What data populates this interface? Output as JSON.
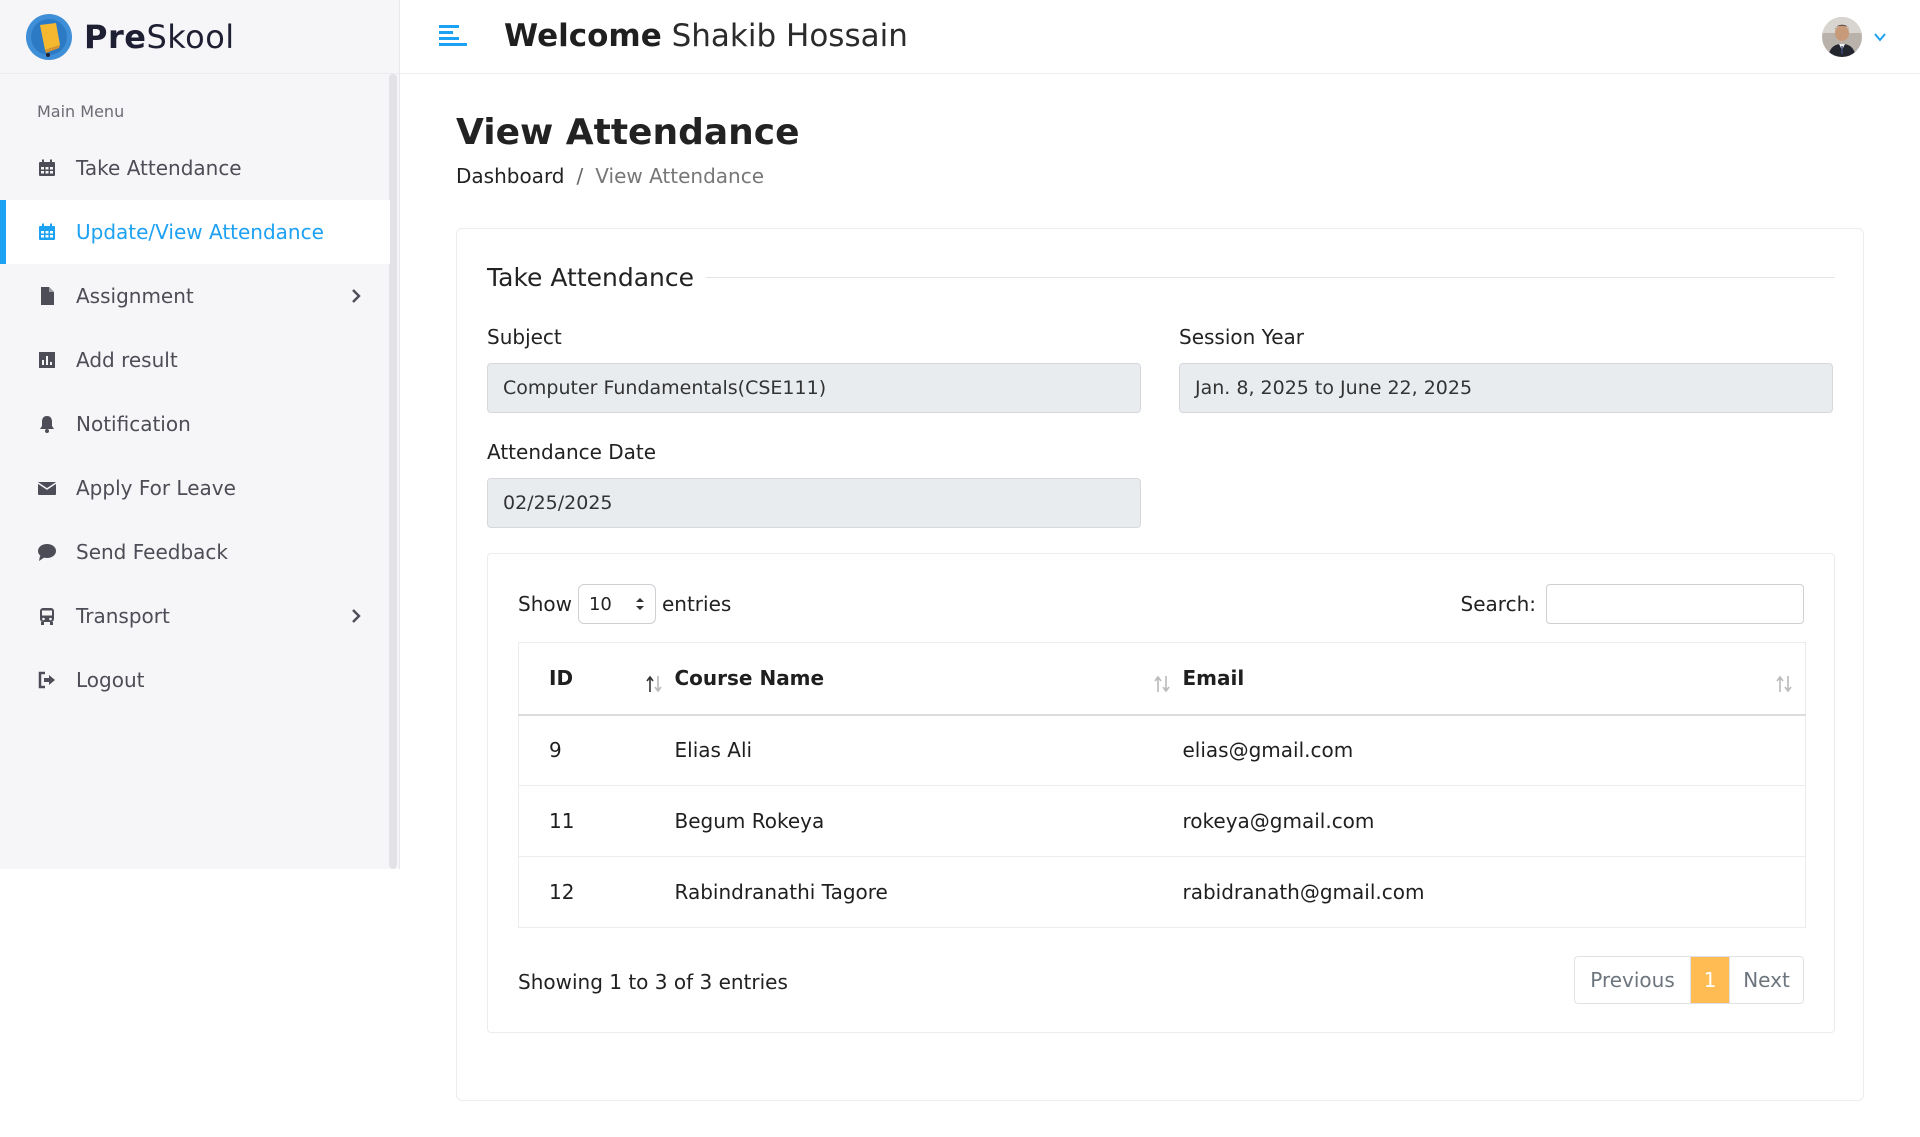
{
  "app": {
    "logo_text_a": "Pre",
    "logo_text_b": "Skool"
  },
  "header": {
    "welcome_strong": "Welcome",
    "user_name": "Shakib Hossain"
  },
  "sidebar": {
    "menu_title": "Main Menu",
    "items": [
      {
        "label": "Take Attendance",
        "icon": "calendar-icon"
      },
      {
        "label": "Update/View Attendance",
        "icon": "calendar-icon",
        "active": true
      },
      {
        "label": "Assignment",
        "icon": "file-icon",
        "has_submenu": true
      },
      {
        "label": "Add result",
        "icon": "chart-icon"
      },
      {
        "label": "Notification",
        "icon": "bell-icon"
      },
      {
        "label": "Apply For Leave",
        "icon": "envelope-icon"
      },
      {
        "label": "Send Feedback",
        "icon": "comment-icon"
      },
      {
        "label": "Transport",
        "icon": "bus-icon",
        "has_submenu": true
      },
      {
        "label": "Logout",
        "icon": "sign-out-icon"
      }
    ]
  },
  "page": {
    "title": "View Attendance",
    "breadcrumb": {
      "home": "Dashboard",
      "separator": "/",
      "current": "View Attendance"
    }
  },
  "form": {
    "section_title": "Take Attendance",
    "subject_label": "Subject",
    "subject_value": "Computer Fundamentals(CSE111)",
    "session_label": "Session Year",
    "session_value": "Jan. 8, 2025 to June 22, 2025",
    "date_label": "Attendance Date",
    "date_value": "02/25/2025"
  },
  "datatable": {
    "show_label": "Show",
    "page_length": "10",
    "entries_label": "entries",
    "search_label": "Search:",
    "columns": [
      "ID",
      "Course Name",
      "Email"
    ],
    "rows": [
      {
        "id": "9",
        "name": "Elias Ali",
        "email": "elias@gmail.com"
      },
      {
        "id": "11",
        "name": "Begum Rokeya",
        "email": "rokeya@gmail.com"
      },
      {
        "id": "12",
        "name": "Rabindranathi Tagore",
        "email": "rabidranath@gmail.com"
      }
    ],
    "info": "Showing 1 to 3 of 3 entries",
    "pagination": {
      "previous": "Previous",
      "current_page": "1",
      "next": "Next"
    }
  },
  "colors": {
    "accent": "#1da1f2",
    "pager_active": "#ffbc53",
    "sidebar_bg": "#f6f6f8",
    "input_bg": "#e9ecef"
  }
}
